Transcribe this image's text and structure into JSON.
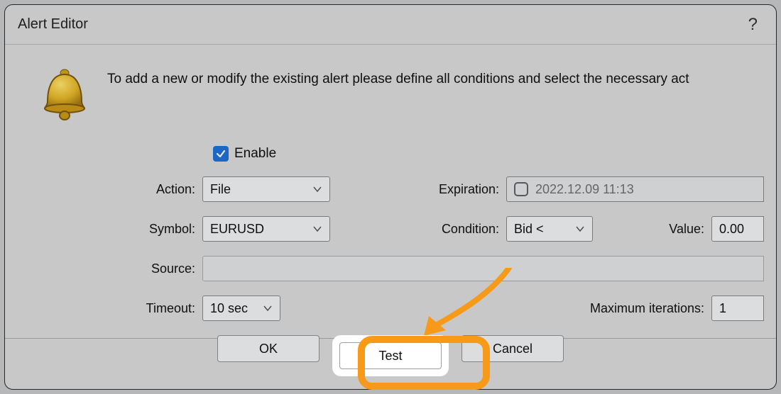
{
  "title": "Alert Editor",
  "intro_text": "To add a new or modify the existing alert please define all conditions and select the necessary act",
  "enable": {
    "label": "Enable",
    "checked": true
  },
  "labels": {
    "action": "Action:",
    "expiration": "Expiration:",
    "symbol": "Symbol:",
    "condition": "Condition:",
    "value": "Value:",
    "source": "Source:",
    "timeout": "Timeout:",
    "max_iter": "Maximum iterations:"
  },
  "fields": {
    "action": "File",
    "expiration": "2022.12.09 11:13",
    "expiration_checked": false,
    "symbol": "EURUSD",
    "condition": "Bid <",
    "value": "0.00",
    "source": "",
    "timeout": "10 sec",
    "max_iter": "1"
  },
  "buttons": {
    "ok": "OK",
    "test": "Test",
    "cancel": "Cancel"
  },
  "help": "?"
}
